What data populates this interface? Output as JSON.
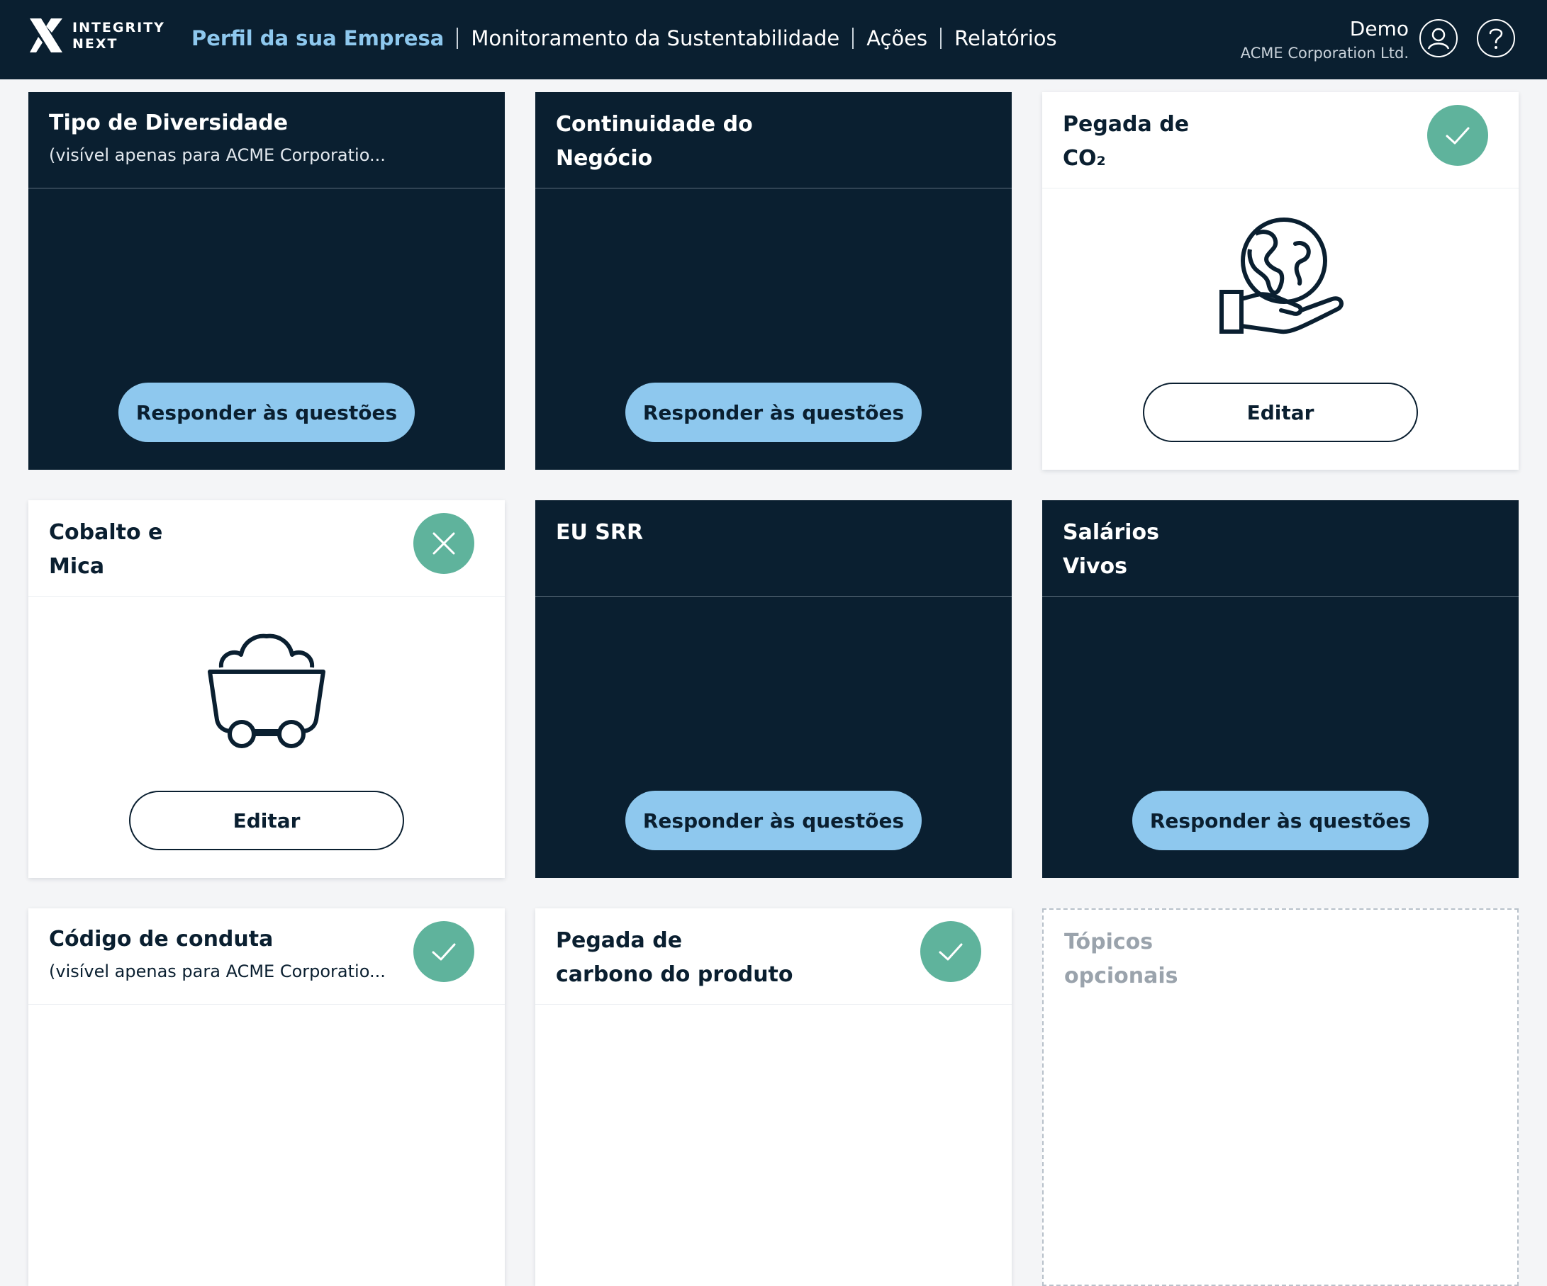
{
  "app": {
    "logo_line1": "INTEGRITY",
    "logo_line2": "NEXT"
  },
  "nav": {
    "items": [
      {
        "label": "Perfil da sua Empresa"
      },
      {
        "label": "Monitoramento da Sustentabilidade"
      },
      {
        "label": "Ações"
      },
      {
        "label": "Relatórios"
      }
    ],
    "active_index": 0
  },
  "user": {
    "name": "Demo",
    "company": "ACME Corporation Ltd.",
    "help_icon": "question-icon",
    "avatar_icon": "user-icon"
  },
  "cards": [
    {
      "title": "Tipo de Diversidade",
      "subtitle": "(visível apenas para ACME Corporatio...",
      "button": "Responder às questões"
    },
    {
      "title_line1": "Continuidade do",
      "title_line2": "Negócio",
      "button": "Responder às questões"
    },
    {
      "title_line1": "Pegada de",
      "title_line2": "CO₂",
      "status_icon": "check-icon",
      "illustration": "globe-hand-icon",
      "button": "Editar"
    },
    {
      "title_line1": "Cobalto e",
      "title_line2": "Mica",
      "status_icon": "x-icon",
      "illustration": "mine-cart-icon",
      "button": "Editar"
    },
    {
      "title": "EU SRR",
      "button": "Responder às questões"
    },
    {
      "title_line1": "Salários",
      "title_line2": "Vivos",
      "button": "Responder às questões"
    },
    {
      "title": "Código de conduta",
      "subtitle": "(visível apenas para ACME Corporatio...",
      "status_icon": "check-icon"
    },
    {
      "title_line1": "Pegada de",
      "title_line2": "carbono do produto",
      "status_icon": "check-icon"
    },
    {
      "title_line1": "Tópicos",
      "title_line2": "opcionais"
    }
  ],
  "colors": {
    "navy": "#0a1f30",
    "accent_blue": "#8ec8ee",
    "status_green": "#5fb39c",
    "background": "#f4f5f7"
  }
}
